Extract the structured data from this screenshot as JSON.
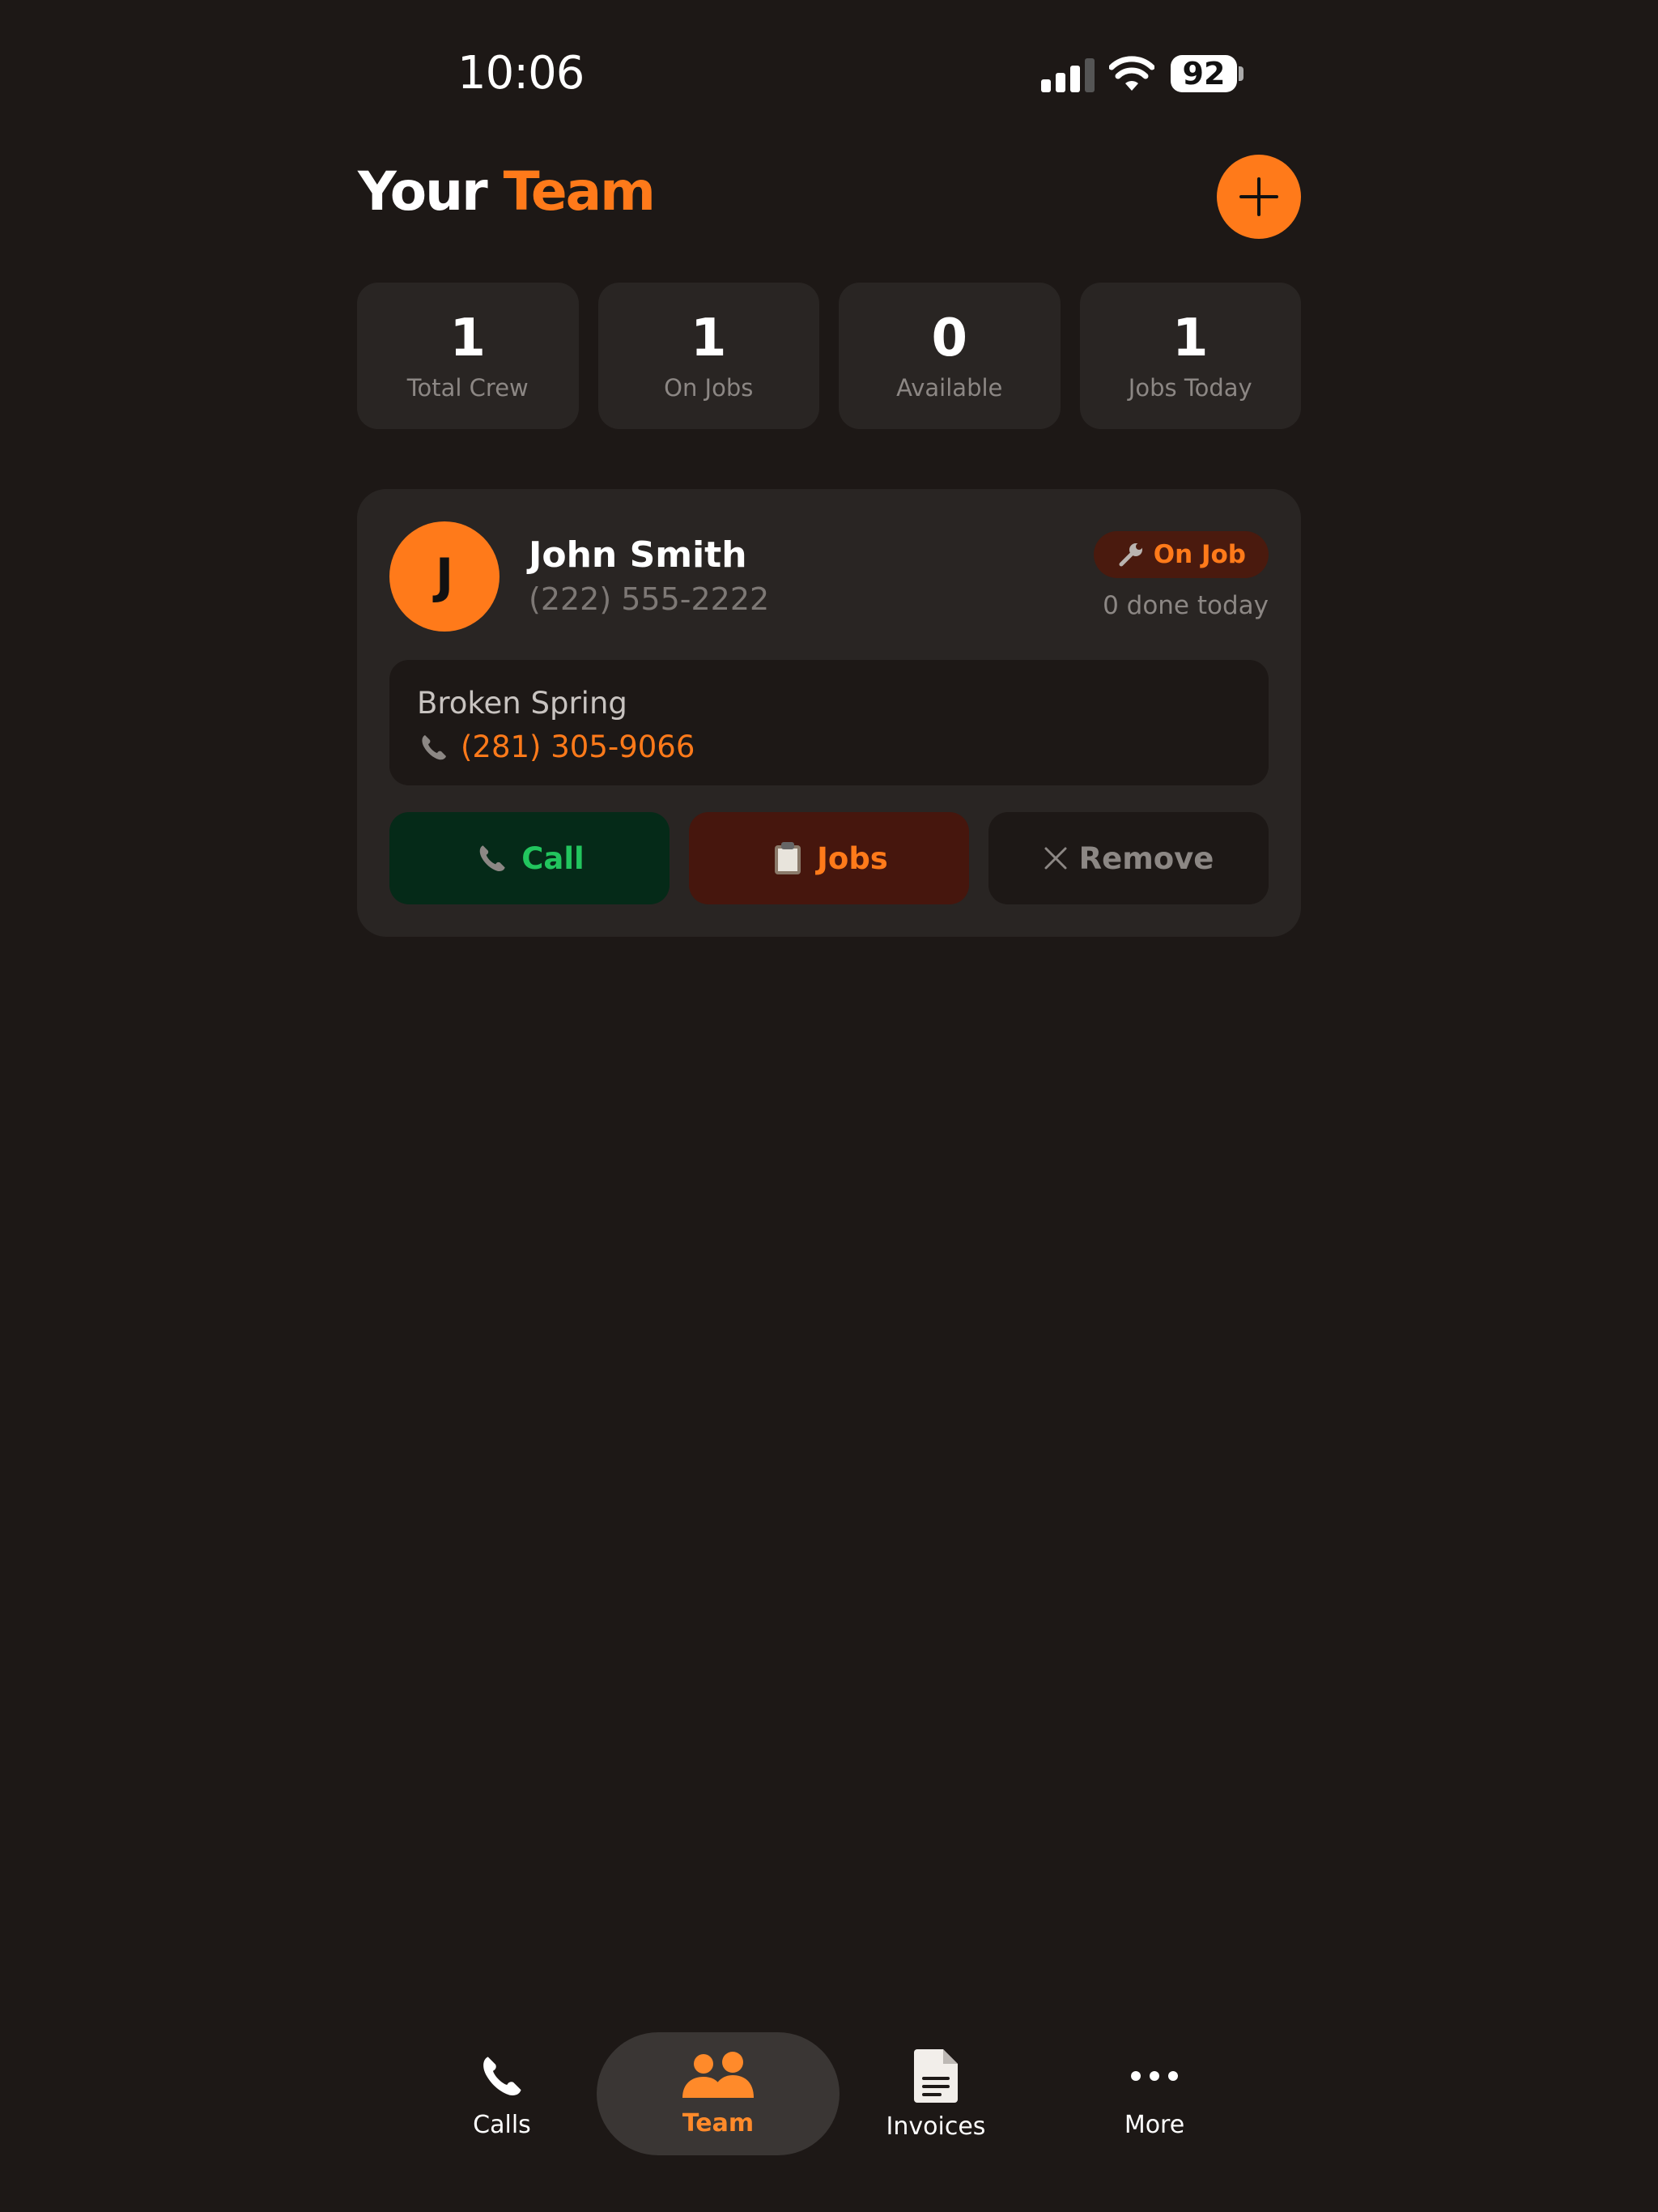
{
  "status_bar": {
    "time": "10:06",
    "battery": "92"
  },
  "header": {
    "title_prefix": "Your",
    "title_accent": "Team"
  },
  "stats": [
    {
      "value": "1",
      "label": "Total Crew"
    },
    {
      "value": "1",
      "label": "On Jobs"
    },
    {
      "value": "0",
      "label": "Available"
    },
    {
      "value": "1",
      "label": "Jobs Today"
    }
  ],
  "member": {
    "initial": "J",
    "name": "John Smith",
    "phone": "(222) 555-2222",
    "status": "On Job",
    "done_today": "0 done today",
    "job": {
      "title": "Broken Spring",
      "phone": "(281) 305-9066"
    },
    "actions": {
      "call": "Call",
      "jobs": "Jobs",
      "remove": "Remove"
    }
  },
  "tabs": [
    {
      "label": "Calls",
      "icon": "phone-icon"
    },
    {
      "label": "Team",
      "icon": "team-icon",
      "active": true
    },
    {
      "label": "Invoices",
      "icon": "document-icon"
    },
    {
      "label": "More",
      "icon": "more-icon"
    }
  ],
  "colors": {
    "accent": "#ff7a1a",
    "background": "#1d1816",
    "card": "#292523",
    "call_green": "#22c55e"
  }
}
